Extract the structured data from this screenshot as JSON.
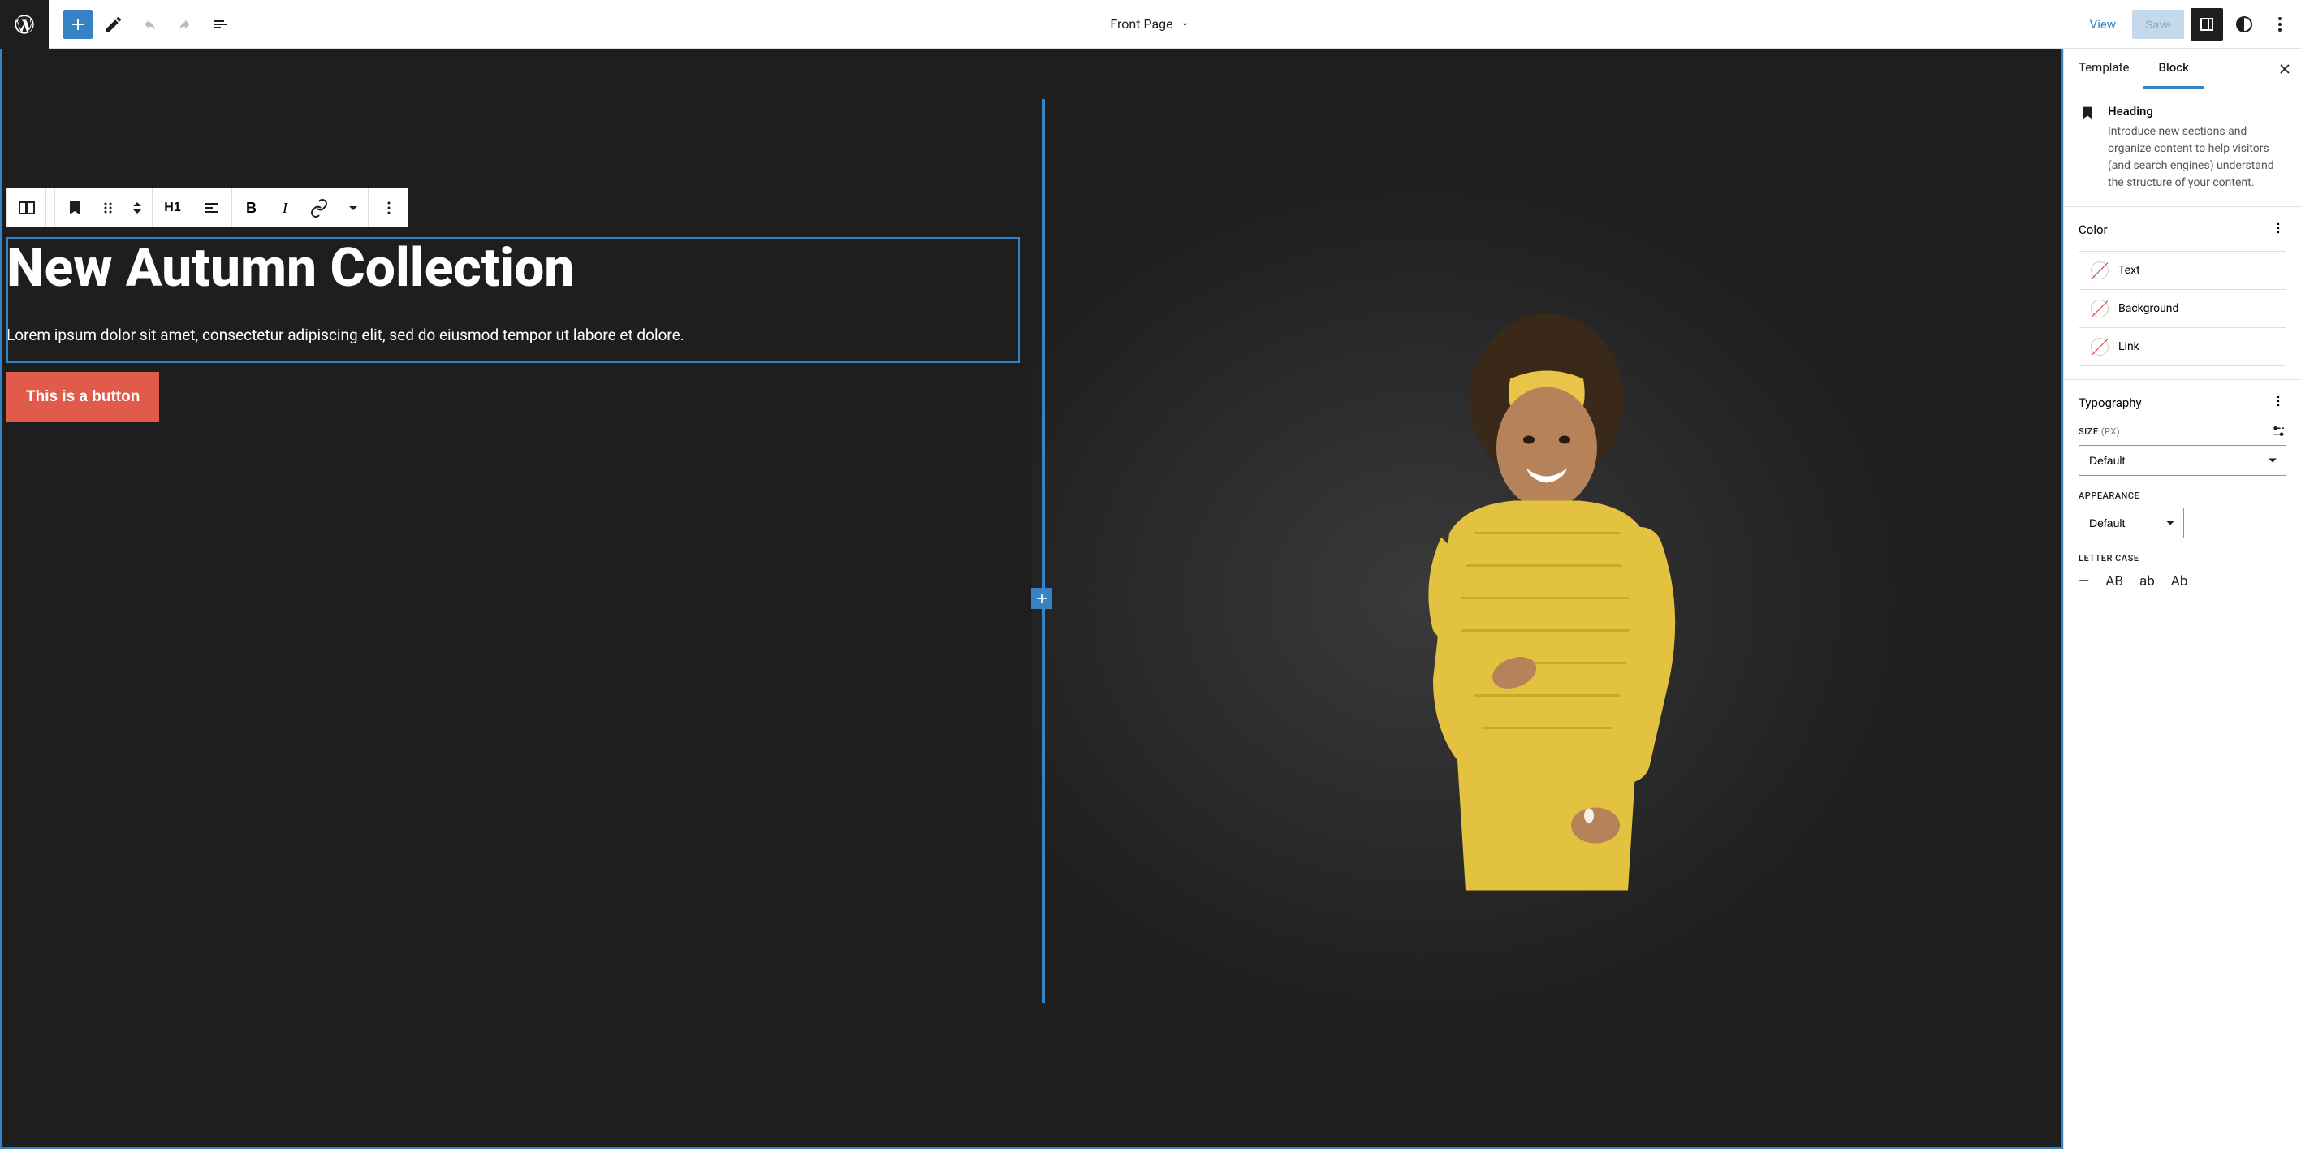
{
  "topbar": {
    "document_title": "Front Page",
    "view_link": "View",
    "save_button": "Save"
  },
  "canvas": {
    "heading": "New Autumn Collection",
    "paragraph": "Lorem ipsum dolor sit amet, consectetur adipiscing elit, sed do eiusmod tempor ut labore et dolore.",
    "button_label": "This is a button",
    "toolbar": {
      "heading_level": "H1"
    }
  },
  "sidebar": {
    "tabs": {
      "template": "Template",
      "block": "Block"
    },
    "block_info": {
      "title": "Heading",
      "description": "Introduce new sections and organize content to help visitors (and search engines) understand the structure of your content."
    },
    "color": {
      "title": "Color",
      "items": [
        "Text",
        "Background",
        "Link"
      ]
    },
    "typography": {
      "title": "Typography",
      "size_label": "SIZE",
      "size_unit": "(PX)",
      "size_value": "Default",
      "appearance_label": "APPEARANCE",
      "appearance_value": "Default",
      "lettercase_label": "LETTER CASE",
      "lettercase_options": [
        "—",
        "AB",
        "ab",
        "Ab"
      ]
    }
  }
}
